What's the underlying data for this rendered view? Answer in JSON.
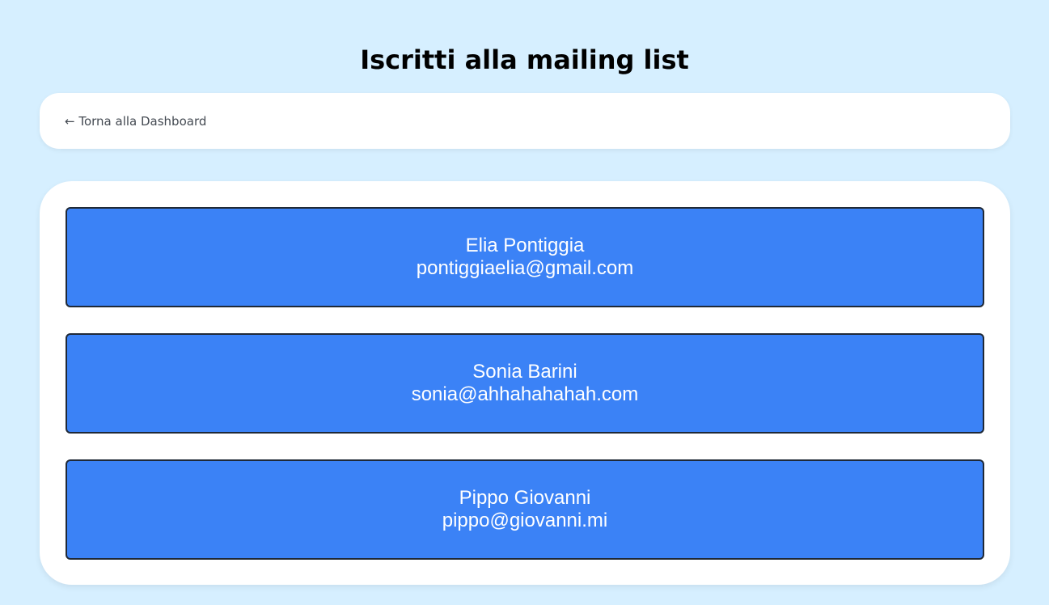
{
  "header": {
    "title": "Iscritti alla mailing list"
  },
  "nav": {
    "back_label": "← Torna alla Dashboard"
  },
  "subscribers": [
    {
      "name": "Elia Pontiggia",
      "email": "pontiggiaelia@gmail.com"
    },
    {
      "name": "Sonia Barini",
      "email": "sonia@ahhahahahah.com"
    },
    {
      "name": "Pippo Giovanni",
      "email": "pippo@giovanni.mi"
    }
  ],
  "colors": {
    "background": "#d6efff",
    "card": "#ffffff",
    "subscriber_bg": "#3b82f6",
    "subscriber_border": "#1f2937"
  }
}
